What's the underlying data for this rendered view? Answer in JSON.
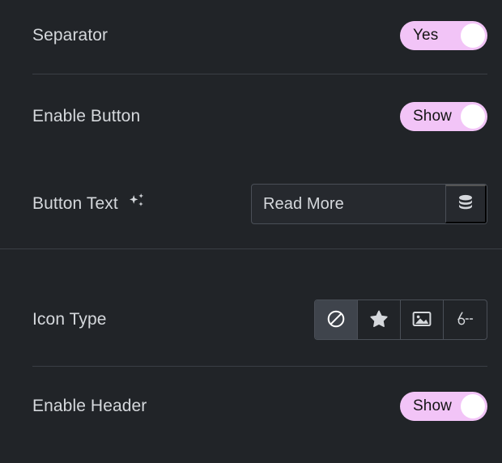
{
  "theme": {
    "background": "#212428",
    "divider": "#3a3f45",
    "label_color": "#d5d8dc",
    "toggle_on_color": "#f2c4f7",
    "toggle_knob_color": "#ffffff",
    "toggle_text_color": "#141414",
    "field_border": "#4a4f57",
    "field_background": "#26292e",
    "active_choice_background": "#3f444c",
    "icon_color": "#d5d8dc"
  },
  "controls": {
    "separator": {
      "label": "Separator",
      "toggle_value": "Yes",
      "state": "on"
    },
    "enable_button": {
      "label": "Enable Button",
      "toggle_value": "Show",
      "state": "on"
    },
    "button_text": {
      "label": "Button Text",
      "ai_icon": "sparkle-icon",
      "value": "Read More",
      "placeholder": "Read More",
      "addon_icon": "database-icon"
    },
    "icon_type": {
      "label": "Icon Type",
      "options": [
        {
          "name": "none",
          "icon": "circle-slash-icon",
          "selected": true
        },
        {
          "name": "icon",
          "icon": "star-icon",
          "selected": false
        },
        {
          "name": "image",
          "icon": "image-icon",
          "selected": false
        },
        {
          "name": "lottie",
          "icon": "lottie-animation-icon",
          "selected": false
        }
      ]
    },
    "enable_header": {
      "label": "Enable Header",
      "toggle_value": "Show",
      "state": "on"
    }
  }
}
